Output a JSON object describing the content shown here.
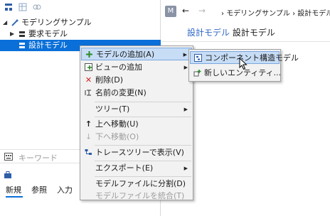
{
  "tree": {
    "root_label": "モデリングサンプル",
    "items": [
      {
        "label": "要求モデル"
      },
      {
        "label": "設計モデル"
      }
    ]
  },
  "search": {
    "placeholder": "キーワード"
  },
  "bottom_tabs": [
    "新規",
    "参照",
    "入力"
  ],
  "nav": {
    "badge": "M",
    "back": "←",
    "forward": "→",
    "breadcrumb": [
      "モデリングサンプル",
      "設計モデル"
    ],
    "breadcrumb_sep": "›"
  },
  "page": {
    "title_link": "設計モデル",
    "title_rest": "設計モデル"
  },
  "context_menu": {
    "items": [
      {
        "label": "モデルの追加(A)",
        "icon": "add-model-icon",
        "submenu": true,
        "highlighted": true
      },
      {
        "label": "ビューの追加",
        "icon": "add-view-icon",
        "submenu": true
      },
      {
        "label": "削除(D)",
        "icon": "delete-icon"
      },
      {
        "label": "名前の変更(N)",
        "icon": "rename-icon"
      },
      {
        "label": "ツリー(T)",
        "submenu": true
      },
      {
        "label": "上へ移動(U)",
        "icon": "up-arrow-icon"
      },
      {
        "label": "下へ移動(O)",
        "icon": "down-arrow-icon",
        "disabled": true
      },
      {
        "label": "トレースツリーで表示(V)",
        "icon": "trace-tree-icon"
      },
      {
        "label": "エクスポート(E)",
        "submenu": true
      },
      {
        "label": "モデルファイルに分割(D)"
      },
      {
        "label": "モデルファイルを統合(T)",
        "disabled": true
      }
    ]
  },
  "submenu": {
    "items": [
      {
        "label": "コンポーネント構造モデル",
        "icon": "component-model-icon",
        "highlighted": true
      },
      {
        "label": "新しいエンティティ...",
        "icon": "new-entity-icon"
      }
    ]
  },
  "colors": {
    "selection": "#0a6fd8",
    "menu_highlight": "#c7ddf6",
    "link": "#2f66c8"
  }
}
